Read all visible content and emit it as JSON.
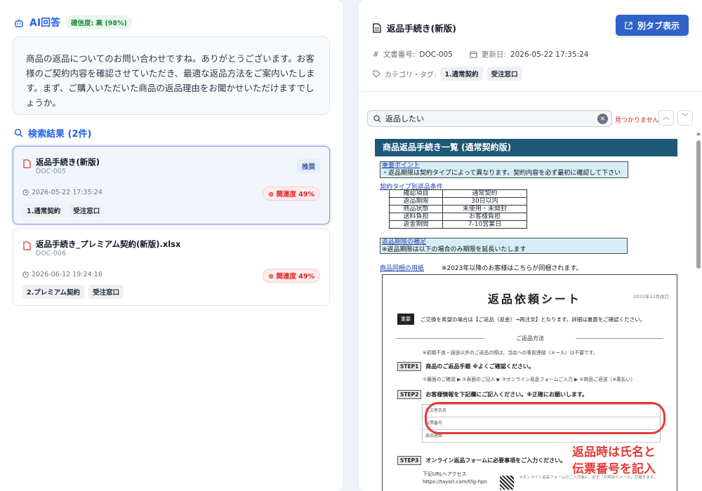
{
  "left": {
    "ai_title": "AI回答",
    "confidence": "確信度: 高 (98%)",
    "answer": "商品の返品についてのお問い合わせですね。ありがとうございます。お客様のご契約内容を確認させていただき、最適な返品方法をご案内いたします。まず、ご購入いただいた商品の返品理由をお聞かせいただけますでしょうか。",
    "results_title": "検索結果 (2件)",
    "results": [
      {
        "name": "返品手続き(新版)",
        "doc_id": "DOC-005",
        "badge": "推奨",
        "date": "2026-05-22 17:35:24",
        "relevance": "関連度 49%",
        "tags": [
          "1.通常契約",
          "受注窓口"
        ]
      },
      {
        "name": "返品手続き_プレミアム契約(新版).xlsx",
        "doc_id": "DOC-006",
        "date": "2026-06-12 19:24:16",
        "relevance": "関連度 49%",
        "tags": [
          "2.プレミアム契約",
          "受注窓口"
        ]
      }
    ]
  },
  "right": {
    "doc_title": "返品手続き(新版)",
    "new_tab_button": "別タブ表示",
    "doc_no_label": "文書番号:",
    "doc_no": "DOC-005",
    "updated_label": "更新日:",
    "updated": "2026-05-22 17:35:24",
    "category_label": "カテゴリ・タグ:",
    "tags": [
      "1.通常契約",
      "受注窓口"
    ],
    "search_value": "返品したい",
    "not_found": "見つかりません",
    "preview": {
      "banner": "商品返品手続き一覧 (通常契約版)",
      "note_head": "重要ポイント",
      "note_body": "・返品期限は契約タイプによって異なります。契約内容を必ず最初に確認して下さい",
      "table_title": "契約タイプ別返品条件",
      "table": [
        [
          "確認項目",
          "通常契約"
        ],
        [
          "返品期限",
          "30日以内"
        ],
        [
          "商品状態",
          "未使用・未開封"
        ],
        [
          "送料負担",
          "お客様負担"
        ],
        [
          "返金期間",
          "7-10営業日"
        ]
      ],
      "note2_head": "返品期限の補足",
      "note2_body": "※返品期限は以下の場合のみ期限を延長いたします",
      "caption_link": "商品同梱の用紙",
      "caption_text": "※2023年以降のお客様はこちらが同梱されます。",
      "sheet_title": "返品依頼シート",
      "sheet_date": "2022年12月改訂",
      "important_label": "重要",
      "important_text": "ご交換を希望の場合は【ご返品（返金）→再注文】となります。詳細は裏面をご確認ください。",
      "method_title": "ご返品方法",
      "method_line": "※初期不良・誤送以外のご返品の際は、当店への事前連絡（メール）は不要です。",
      "step1_label": "STEP1",
      "step1_text": "商品のご返品手順 ※よくご確認ください。",
      "step1_sub": "①裏面のご確認 ▶ ②表面のご記入 ▶ ③オンライン返品フォームご入力 ▶ ④商品ご返送（※着払い）",
      "step2_label": "STEP2",
      "step2_text": "お客様情報を下記欄にご記入ください。※正確にお願いします。",
      "grid_rows": [
        "注文者氏名",
        "伝票番号",
        "返品理由"
      ],
      "red_note_1": "返品時は氏名と",
      "red_note_2": "伝票番号を記入",
      "step3_label": "STEP3",
      "step3_text": "オンライン返品フォームに必要事項をご入力ください。",
      "url_label": "下記URLへアクセス",
      "url": "https://tayori.com/f/lg-hpn",
      "qr_note": "※オンライン返品フォームのご入力後に、必ず「お問合せメール」が届きます。"
    }
  },
  "colors": {
    "accent": "#2563eb",
    "button": "#2f63c9",
    "danger": "#dc2626",
    "banner": "#1d5876"
  }
}
